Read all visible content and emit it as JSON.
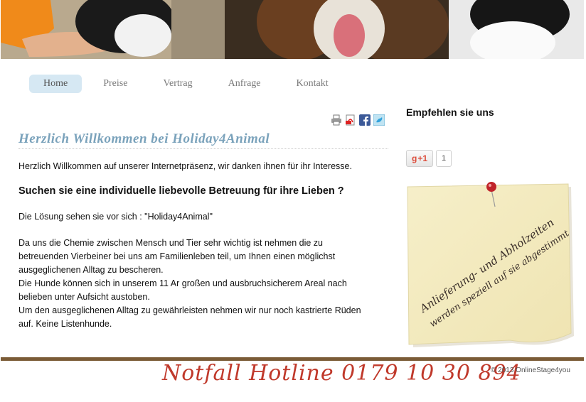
{
  "nav": {
    "items": [
      {
        "label": "Home",
        "active": true
      },
      {
        "label": "Preise",
        "active": false
      },
      {
        "label": "Vertrag",
        "active": false
      },
      {
        "label": "Anfrage",
        "active": false
      },
      {
        "label": "Kontakt",
        "active": false
      }
    ]
  },
  "share": {
    "icons": [
      "print-icon",
      "pdf-icon",
      "facebook-icon",
      "twitter-icon"
    ]
  },
  "main": {
    "title": "Herzlich Willkommen bei Holiday4Animal",
    "intro": "Herzlich Willkommen auf unserer Internetpräsenz, wir danken ihnen für ihr Interesse.",
    "subhead": "Suchen sie eine individuelle liebevolle Betreuung für ihre Lieben ?",
    "solution": "Die Lösung sehen sie vor sich : \"Holiday4Animal\"",
    "paragraph_lines": [
      "Da uns die Chemie zwischen Mensch und Tier sehr wichtig ist nehmen die zu",
      "betreuenden Vierbeiner bei uns am Familienleben teil, um Ihnen einen möglichst",
      "ausgeglichenen Alltag zu bescheren.",
      "Die Hunde können sich in unserem 11 Ar großen und ausbruchsicherem Areal nach",
      "belieben unter Aufsicht austoben.",
      "Um den ausgeglichenen Alltag zu gewährleisten nehmen wir nur noch kastrierte Rüden",
      "auf. Keine Listenhunde."
    ]
  },
  "sidebar": {
    "title": "Empfehlen sie uns",
    "gplus_label": "+1",
    "gplus_count": "1",
    "note_line1": "Anlieferung- und Abholzeiten",
    "note_line2": "werden speziell auf sie abgestimmt"
  },
  "footer": {
    "hotline": "Notfall Hotline 0179 10 30 894",
    "copyright": "© 2013 OnlineStage4you"
  },
  "colors": {
    "nav_active_bg": "#d6e8f3",
    "title_color": "#7aa2bb",
    "footer_bar": "#7a5b36",
    "hotline": "#c0392b"
  }
}
